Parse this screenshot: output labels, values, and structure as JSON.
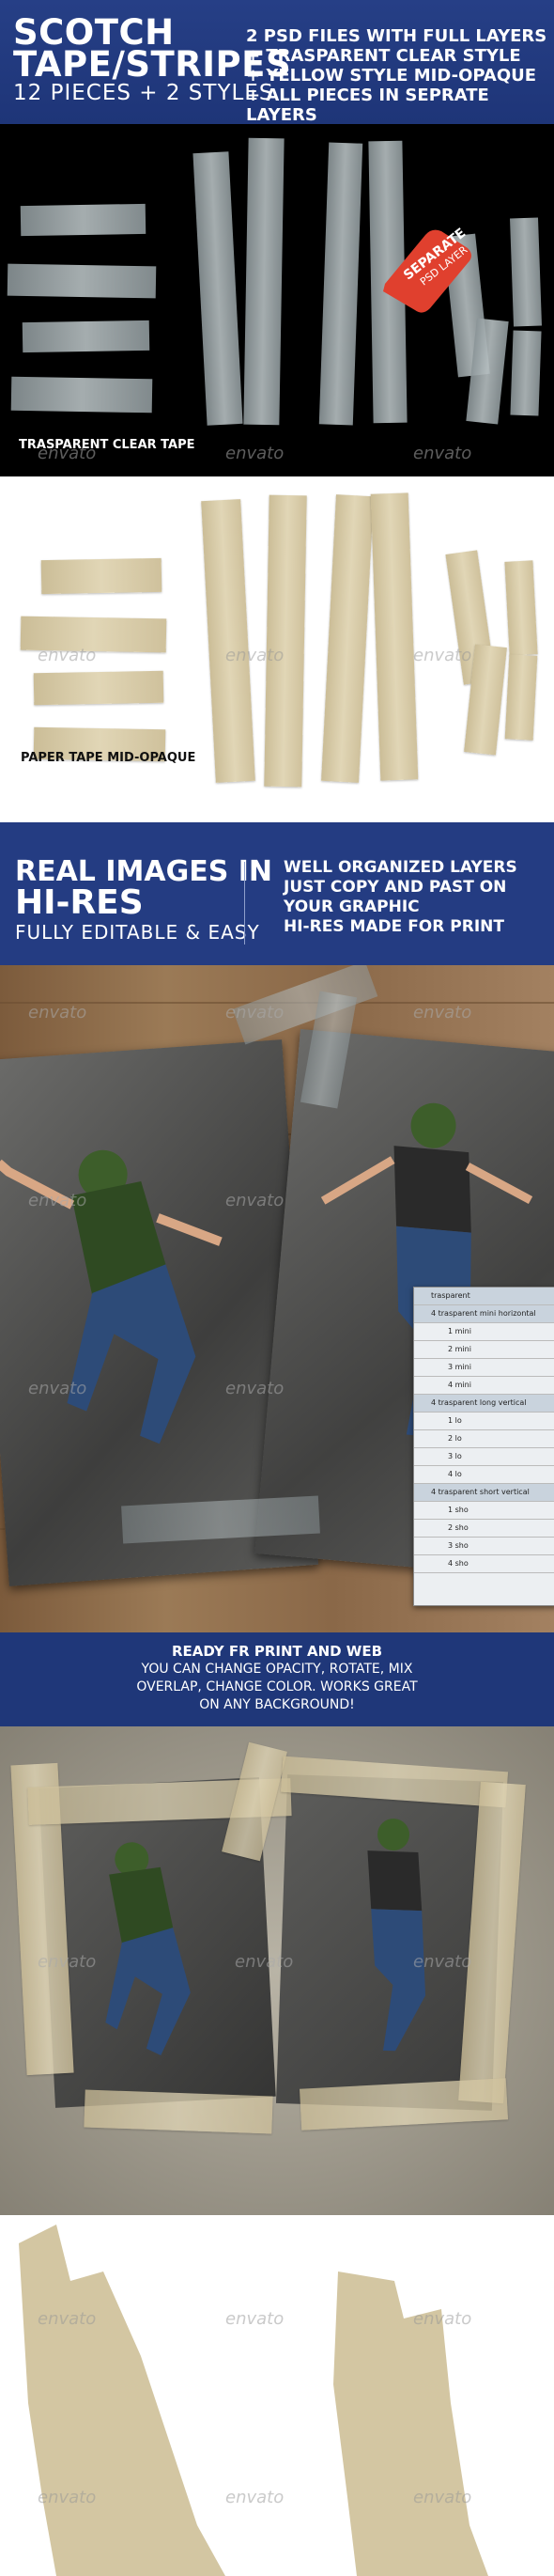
{
  "header": {
    "title_line1": "SCOTCH",
    "title_line2": "TAPE/STRIPES",
    "subtitle": "12 PIECES + 2 STYLES",
    "features": [
      "2 PSD FILES WITH FULL LAYERS",
      "+ TRASPARENT CLEAR STYLE",
      "+ YELLOW STYLE MID-OPAQUE",
      "+ ALL PIECES IN SEPRATE LAYERS"
    ]
  },
  "clear_section": {
    "badge_line1": "SEPARATE",
    "badge_line2": "PSD LAYER",
    "caption": "TRASPARENT CLEAR TAPE"
  },
  "paper_section": {
    "caption": "PAPER TAPE MID-OPAQUE"
  },
  "hires_section": {
    "title_line1": "REAL IMAGES IN",
    "title_line2": "HI-RES",
    "title_line3": "FULLY EDITABLE & EASY",
    "notes": [
      "WELL ORGANIZED LAYERS",
      "JUST COPY AND PAST ON",
      "YOUR GRAPHIC",
      "HI-RES MADE FOR PRINT"
    ]
  },
  "layers_panel": {
    "rows": [
      {
        "label": "trasparent",
        "group": true
      },
      {
        "label": "4 trasparent mini horizontal",
        "group": true
      },
      {
        "label": "1 mini",
        "group": false
      },
      {
        "label": "2 mini",
        "group": false
      },
      {
        "label": "3 mini",
        "group": false
      },
      {
        "label": "4 mini",
        "group": false
      },
      {
        "label": "4 trasparent long vertical",
        "group": true
      },
      {
        "label": "1 lo",
        "group": false
      },
      {
        "label": "2 lo",
        "group": false
      },
      {
        "label": "3 lo",
        "group": false
      },
      {
        "label": "4 lo",
        "group": false
      },
      {
        "label": "4 trasparent short vertical",
        "group": true
      },
      {
        "label": "1 sho",
        "group": false
      },
      {
        "label": "2 sho",
        "group": false
      },
      {
        "label": "3 sho",
        "group": false
      },
      {
        "label": "4 sho",
        "group": false
      }
    ]
  },
  "print_section": {
    "heading": "READY FR PRINT AND WEB",
    "lines": [
      "YOU CAN CHANGE OPACITY, ROTATE, MIX",
      "OVERLAP, CHANGE COLOR. WORKS GREAT",
      "ON ANY BACKGROUND!"
    ]
  },
  "watermark": "envato",
  "colors": {
    "header_blue": "#263f86",
    "badge_red": "#e0402e",
    "paper_tape": "#d8ccaa",
    "clear_tape": "#a7b1b4"
  }
}
